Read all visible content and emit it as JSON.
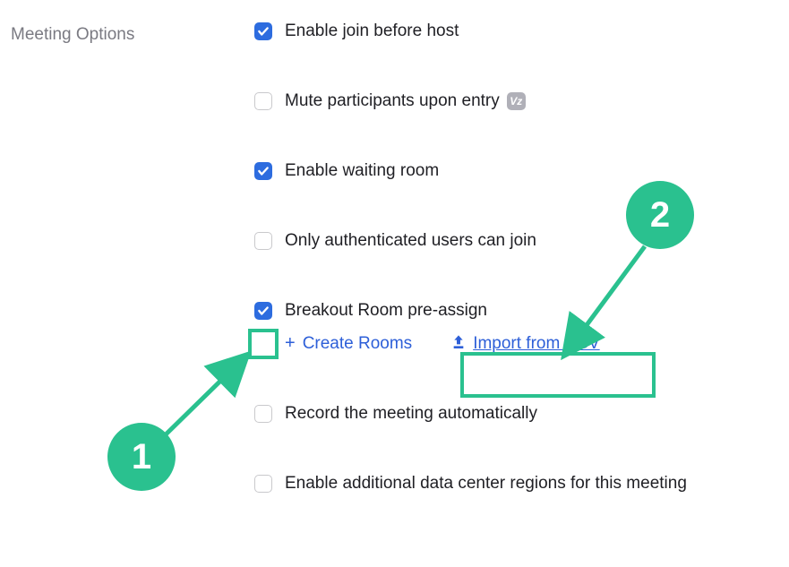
{
  "section_title": "Meeting Options",
  "options": {
    "enable_join_before_host": {
      "label": "Enable join before host",
      "checked": true
    },
    "mute_on_entry": {
      "label": "Mute participants upon entry",
      "checked": false
    },
    "enable_waiting_room": {
      "label": "Enable waiting room",
      "checked": true
    },
    "only_authenticated": {
      "label": "Only authenticated users can join",
      "checked": false
    },
    "breakout_preassign": {
      "label": "Breakout Room pre-assign",
      "checked": true
    },
    "record_auto": {
      "label": "Record the meeting automatically",
      "checked": false
    },
    "data_center_regions": {
      "label": "Enable additional data center regions for this meeting",
      "checked": false
    }
  },
  "breakout_actions": {
    "create_rooms": "Create Rooms",
    "import_csv": "Import from CSV"
  },
  "annotations": {
    "badge1": "1",
    "badge2": "2"
  },
  "vz_badge": "Vz"
}
